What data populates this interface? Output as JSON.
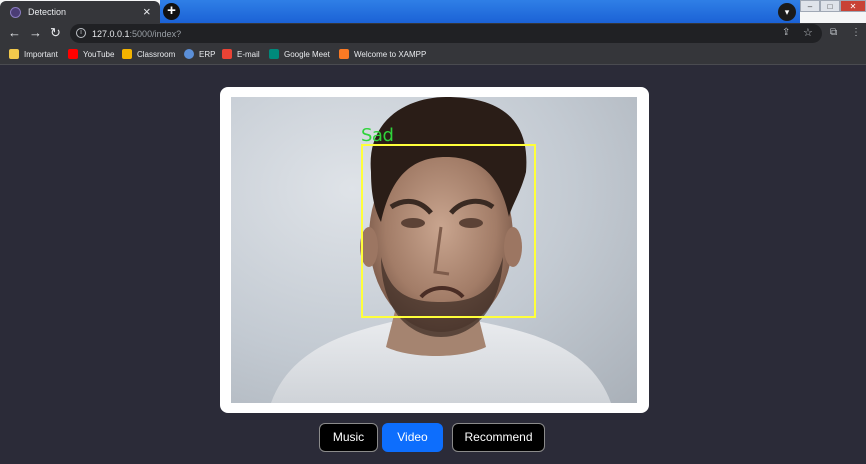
{
  "browser": {
    "tab_title": "Detection",
    "tab_close": "×",
    "new_tab": "+",
    "url_host": "127.0.0.1",
    "url_rest": ":5000/index?",
    "bookmarks": [
      "Important",
      "YouTube",
      "Classroom",
      "ERP",
      "E-mail",
      "Google Meet",
      "Welcome to XAMPP"
    ]
  },
  "detection": {
    "label": "Sad",
    "label_color": "#2fd33b",
    "box_color": "#ffff3a"
  },
  "buttons": {
    "music": "Music",
    "video": "Video",
    "recommend": "Recommend",
    "active": "Video",
    "active_color": "#0d6efd"
  }
}
